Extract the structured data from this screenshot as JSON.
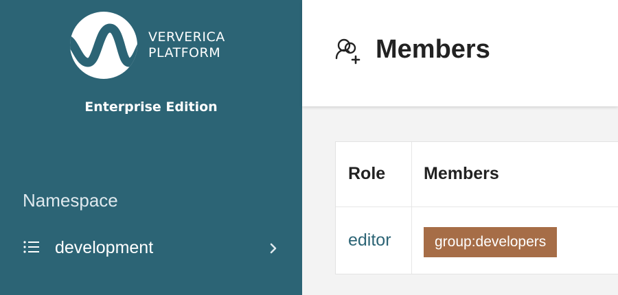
{
  "sidebar": {
    "brand": {
      "line1": "VERVERICA",
      "line2": "PLATFORM"
    },
    "edition": "Enterprise Edition",
    "namespace_label": "Namespace",
    "namespace_value": "development"
  },
  "header": {
    "title": "Members"
  },
  "table": {
    "columns": [
      "Role",
      "Members"
    ],
    "rows": [
      {
        "role": "editor",
        "members": [
          "group:developers"
        ]
      }
    ]
  },
  "colors": {
    "sidebar_bg": "#2c6475",
    "badge_bg": "#a66d47",
    "link": "#2c6475"
  },
  "icons": {
    "logo": "ververica-wave-logo",
    "namespace": "list-icon",
    "chevron": "chevron-right-icon",
    "header": "members-add-icon"
  }
}
